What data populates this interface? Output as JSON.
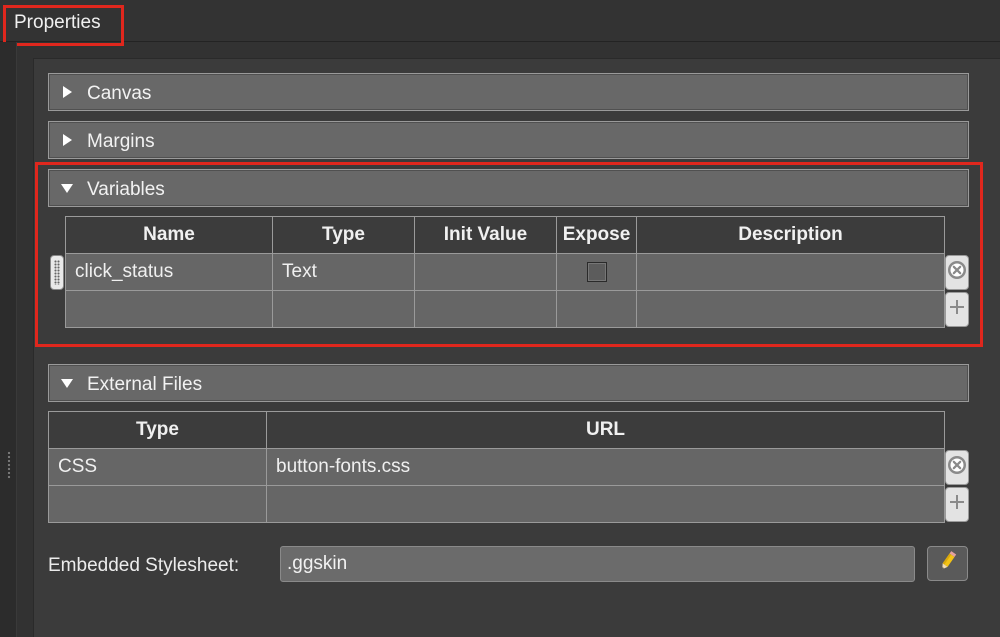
{
  "panel": {
    "title": "Properties"
  },
  "sections": {
    "canvas": {
      "label": "Canvas",
      "expanded": false
    },
    "margins": {
      "label": "Margins",
      "expanded": false
    },
    "variables": {
      "label": "Variables",
      "expanded": true
    },
    "external_files": {
      "label": "External Files",
      "expanded": true
    }
  },
  "variables_table": {
    "columns": [
      "Name",
      "Type",
      "Init Value",
      "Expose",
      "Description"
    ],
    "rows": [
      {
        "name": "click_status",
        "type": "Text",
        "init_value": "",
        "expose": false,
        "description": ""
      },
      {
        "name": "",
        "type": "",
        "init_value": "",
        "expose": null,
        "description": ""
      }
    ]
  },
  "external_files_table": {
    "columns": [
      "Type",
      "URL"
    ],
    "rows": [
      {
        "type": "CSS",
        "url": "button-fonts.css"
      },
      {
        "type": "",
        "url": ""
      }
    ]
  },
  "embedded_stylesheet": {
    "label": "Embedded Stylesheet:",
    "value": ".ggskin"
  },
  "icons": {
    "expand_collapsed": "triangle-right-icon",
    "expand_open": "triangle-down-icon",
    "remove_row": "remove-circle-icon",
    "add_row": "plus-icon",
    "edit": "pencil-icon",
    "drag": "drag-handle-icon"
  },
  "colors": {
    "background": "#323232",
    "section_bar": "#686868",
    "table_header": "#3c3c3c",
    "table_cell": "#666666",
    "highlight": "#e0271d",
    "pencil": "#f3c316"
  }
}
